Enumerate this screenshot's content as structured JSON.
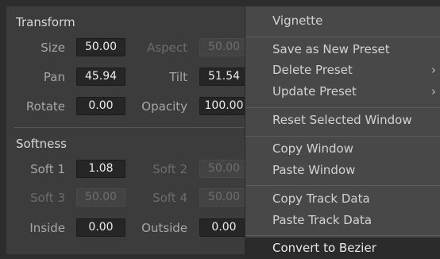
{
  "panel": {
    "transform": {
      "title": "Transform",
      "size": {
        "label": "Size",
        "value": "50.00"
      },
      "aspect": {
        "label": "Aspect",
        "value": "50.00"
      },
      "pan": {
        "label": "Pan",
        "value": "45.94"
      },
      "tilt": {
        "label": "Tilt",
        "value": "51.54"
      },
      "rotate": {
        "label": "Rotate",
        "value": "0.00"
      },
      "opacity": {
        "label": "Opacity",
        "value": "100.00"
      }
    },
    "softness": {
      "title": "Softness",
      "soft1": {
        "label": "Soft 1",
        "value": "1.08"
      },
      "soft2": {
        "label": "Soft 2",
        "value": "50.00"
      },
      "soft3": {
        "label": "Soft 3",
        "value": "50.00"
      },
      "soft4": {
        "label": "Soft 4",
        "value": "50.00"
      },
      "inside": {
        "label": "Inside",
        "value": "0.00"
      },
      "outside": {
        "label": "Outside",
        "value": "0.00"
      }
    }
  },
  "menu": {
    "vignette": "Vignette",
    "save_preset": "Save as New Preset",
    "delete_preset": "Delete Preset",
    "update_preset": "Update Preset",
    "reset_window": "Reset Selected Window",
    "copy_window": "Copy Window",
    "paste_window": "Paste Window",
    "copy_track": "Copy Track Data",
    "paste_track": "Paste Track Data",
    "convert_bezier": "Convert to Bezier",
    "submenu_glyph": "›"
  }
}
